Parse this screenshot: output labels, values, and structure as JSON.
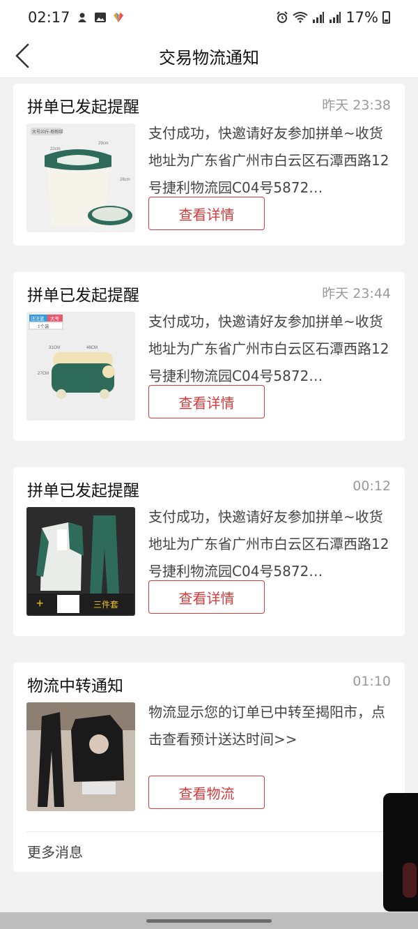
{
  "status_bar": {
    "time": "02:17",
    "battery": "17%"
  },
  "nav": {
    "title": "交易物流通知"
  },
  "cards": [
    {
      "title": "拼单已发起提醒",
      "time": "昨天 23:38",
      "text": "支付成功，快邀请好友参加拼单~收货地址为广东省广州市白云区石潭西路12号捷利物流园C04号5872…",
      "button": "查看详情",
      "thumb": "rice-bucket",
      "thumb_labels": [
        "大号20斤-粉粉绿",
        "29cm",
        "22cm",
        "28cm"
      ]
    },
    {
      "title": "拼单已发起提醒",
      "time": "昨天 23:44",
      "text": "支付成功，快邀请好友参加拼单~收货地址为广东省广州市白云区石潭西路12号捷利物流园C04号5872…",
      "button": "查看详情",
      "thumb": "storage-box",
      "thumb_labels": [
        "汪汪蓝",
        "大号",
        "1个装",
        "31CM",
        "46CM",
        "27CM"
      ]
    },
    {
      "title": "拼单已发起提醒",
      "time": "00:12",
      "text": "支付成功，快邀请好友参加拼单~收货地址为广东省广州市白云区石潭西路12号捷利物流园C04号5872…",
      "button": "查看详情",
      "thumb": "tracksuit",
      "thumb_labels": [
        "三件套",
        "+"
      ]
    },
    {
      "title": "物流中转通知",
      "time": "01:10",
      "text": "物流显示您的订单已中转至揭阳市，点击查看预计送达时间>>",
      "button": "查看物流",
      "thumb": "clothing"
    }
  ],
  "more_link": "更多消息",
  "colors": {
    "accent": "#d83b3b",
    "background": "#f2f2f2",
    "card": "#ffffff",
    "muted": "#9a9a9a"
  }
}
